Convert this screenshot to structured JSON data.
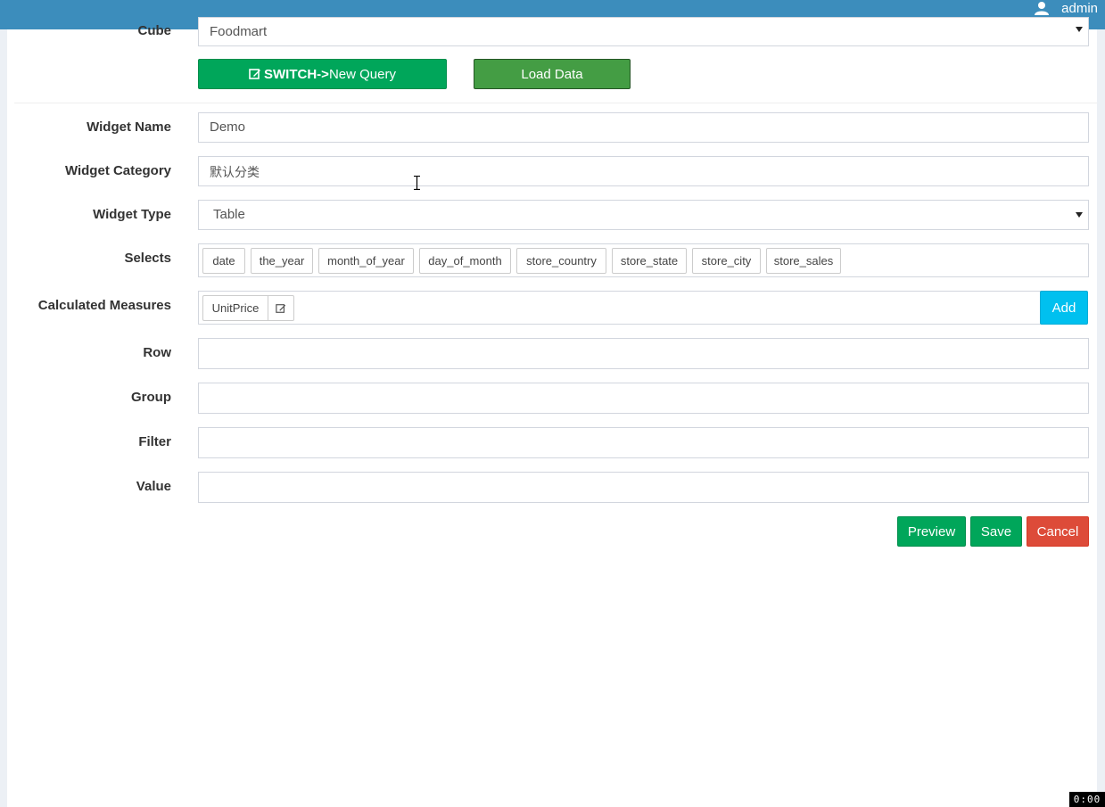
{
  "header": {
    "username": "admin",
    "user_icon": "user-icon"
  },
  "form": {
    "cube": {
      "label": "Cube",
      "value": "Foodmart"
    },
    "switch_button": {
      "icon": "edit-icon",
      "bold": "SWITCH->",
      "rest": "New Query"
    },
    "load_button": "Load Data",
    "widget_name": {
      "label": "Widget Name",
      "value": "Demo"
    },
    "widget_category": {
      "label": "Widget Category",
      "value": "默认分类"
    },
    "widget_type": {
      "label": "Widget Type",
      "value": "Table"
    },
    "selects": {
      "label": "Selects",
      "items": [
        "date",
        "the_year",
        "month_of_year",
        "day_of_month",
        "store_country",
        "store_state",
        "store_city",
        "store_sales"
      ]
    },
    "calculated_measures": {
      "label": "Calculated Measures",
      "items": [
        "UnitPrice"
      ],
      "add_label": "Add"
    },
    "row": {
      "label": "Row",
      "value": ""
    },
    "group": {
      "label": "Group",
      "value": ""
    },
    "filter": {
      "label": "Filter",
      "value": ""
    },
    "value": {
      "label": "Value",
      "value": ""
    }
  },
  "actions": {
    "preview": "Preview",
    "save": "Save",
    "cancel": "Cancel"
  },
  "timer": "0:00",
  "colors": {
    "header": "#3c8dbc",
    "success": "#00a65a",
    "load": "#449d44",
    "info": "#00c0ef",
    "danger": "#dd4b39"
  }
}
